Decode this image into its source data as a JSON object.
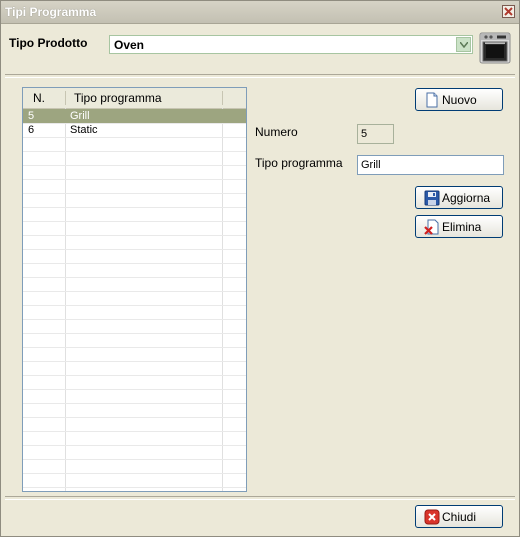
{
  "window": {
    "title": "Tipi Programma"
  },
  "header": {
    "tipo_prodotto_label": "Tipo Prodotto",
    "tipo_prodotto_value": "Oven",
    "product_icon": "oven-icon"
  },
  "grid": {
    "columns": [
      "N.",
      "Tipo programma"
    ],
    "rows": [
      {
        "n": "5",
        "tipo": "Grill",
        "selected": true
      },
      {
        "n": "6",
        "tipo": "Static",
        "selected": false
      }
    ]
  },
  "form": {
    "numero_label": "Numero",
    "numero_value": "5",
    "tipo_programma_label": "Tipo programma",
    "tipo_programma_value": "Grill"
  },
  "buttons": {
    "nuovo": "Nuovo",
    "aggiorna": "Aggiorna",
    "elimina": "Elimina",
    "chiudi": "Chiudi"
  },
  "colors": {
    "selection": "#9da580",
    "window_bg": "#ece9d8"
  }
}
